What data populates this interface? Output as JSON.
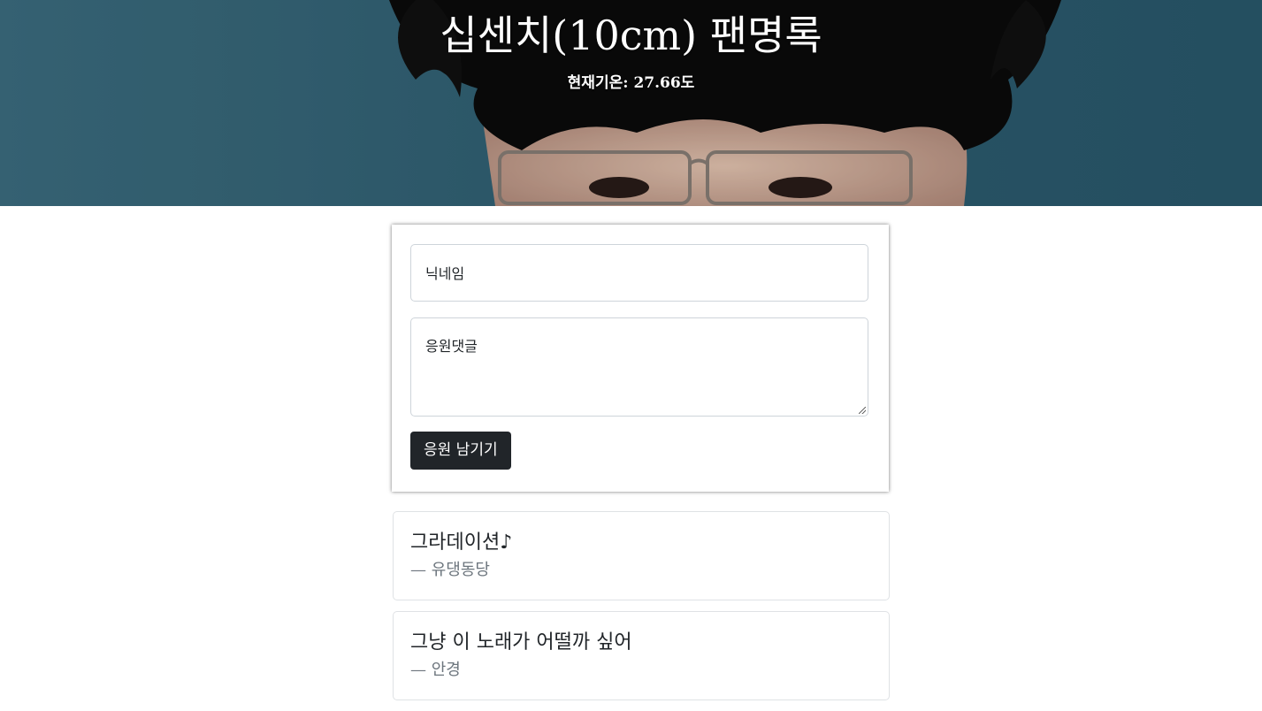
{
  "header": {
    "title": "십센치(10cm) 팬명록",
    "temperature_label": "현재기온:",
    "temperature_value": "27.66도"
  },
  "form": {
    "nickname_placeholder": "닉네임",
    "comment_placeholder": "응원댓글",
    "submit_label": "응원 남기기"
  },
  "comments": [
    {
      "text": "그라데이션♪",
      "author": "— 유댕동당"
    },
    {
      "text": "그냥 이 노래가 어떨까 싶어",
      "author": "— 안경"
    }
  ],
  "colors": {
    "button_bg": "#212529",
    "author_text": "#6c757d"
  }
}
